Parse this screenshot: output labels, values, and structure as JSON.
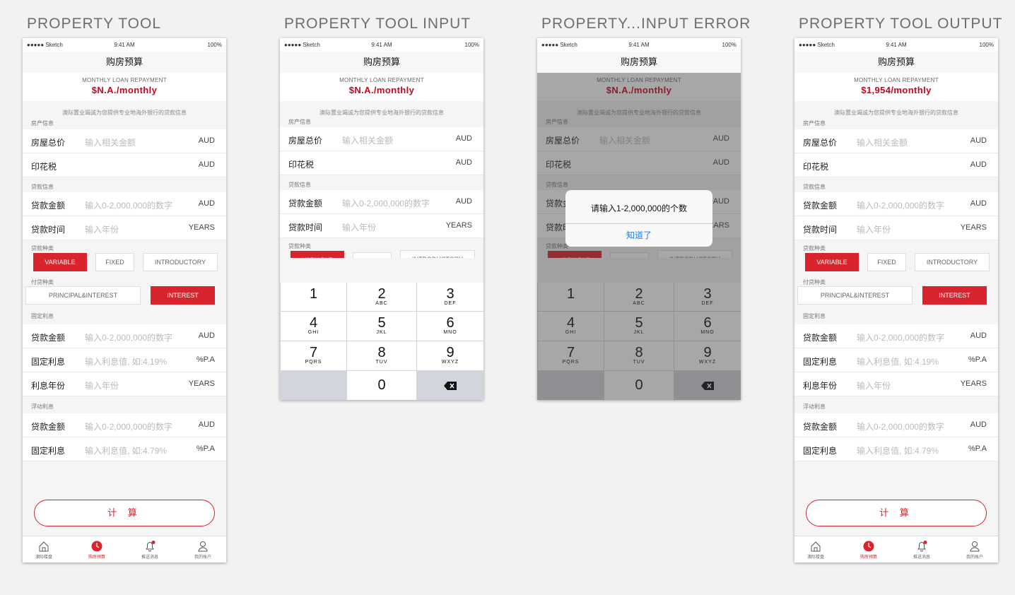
{
  "boards": [
    {
      "title": "PROPERTY TOOL"
    },
    {
      "title": "PROPERTY TOOL INPUT"
    },
    {
      "title": "PROPERTY...INPUT ERROR"
    },
    {
      "title": "PROPERTY TOOL OUTPUT"
    }
  ],
  "status": {
    "carrier": "●●●●● Sketch",
    "time": "9:41 AM",
    "battery": "100%"
  },
  "nav_title": "购房预算",
  "hero_label": "MONTHLY LOAN REPAYMENT",
  "hero_value_empty": "$N.A./monthly",
  "hero_value_result": "$1,954/monthly",
  "notice": "澳际置业竭诚为您提供专业地海外银行的贷款信息",
  "sections": {
    "property": "房产信息",
    "loan": "贷款信息",
    "loan_type": "贷款种类",
    "pay_type": "付贷种类",
    "fixed_rate": "固定利息",
    "float_rate": "浮动利息"
  },
  "fields": {
    "house_price": {
      "label": "房屋总价",
      "placeholder": "输入相关金额",
      "unit": "AUD"
    },
    "stamp_duty": {
      "label": "印花税",
      "unit": "AUD"
    },
    "loan_amount": {
      "label": "贷款金额",
      "placeholder": "输入0-2,000,000的数字",
      "unit": "AUD"
    },
    "loan_term": {
      "label": "贷款时间",
      "placeholder": "输入年份",
      "unit": "YEARS"
    },
    "fixed_amount": {
      "label": "贷款金额",
      "placeholder": "输入0-2,000,000的数字",
      "unit": "AUD"
    },
    "fixed_rate": {
      "label": "固定利息",
      "placeholder": "输入利息值, 如:4.19%",
      "unit": "%P.A"
    },
    "fixed_years": {
      "label": "利息年份",
      "placeholder": "输入年份",
      "unit": "YEARS"
    },
    "float_amount": {
      "label": "贷款金额",
      "placeholder": "输入0-2,000,000的数字",
      "unit": "AUD"
    },
    "float_rate": {
      "label": "固定利息",
      "placeholder": "输入利息值, 如:4.79%",
      "unit": "%P.A"
    }
  },
  "loan_types": {
    "variable": "VARIABLE",
    "fixed": "FIXED",
    "intro": "INTRODUCTORY"
  },
  "pay_types": {
    "pi": "PRINCIPAL&INTEREST",
    "io": "INTEREST"
  },
  "calc_label": "计 算",
  "tabs": {
    "home": "澳际楼盘",
    "budget": "购房预算",
    "news": "推送消息",
    "account": "我的账户"
  },
  "keypad": {
    "k1": {
      "n": "1",
      "s": ""
    },
    "k2": {
      "n": "2",
      "s": "ABC"
    },
    "k3": {
      "n": "3",
      "s": "DEF"
    },
    "k4": {
      "n": "4",
      "s": "GHI"
    },
    "k5": {
      "n": "5",
      "s": "JKL"
    },
    "k6": {
      "n": "6",
      "s": "MNO"
    },
    "k7": {
      "n": "7",
      "s": "PQRS"
    },
    "k8": {
      "n": "8",
      "s": "TUV"
    },
    "k9": {
      "n": "9",
      "s": "WXYZ"
    },
    "k0": {
      "n": "0",
      "s": ""
    }
  },
  "alert": {
    "message": "请输入1-2,000,000的个数",
    "button": "知道了"
  },
  "colors": {
    "accent": "#d9232d",
    "link": "#1a7ee9"
  }
}
